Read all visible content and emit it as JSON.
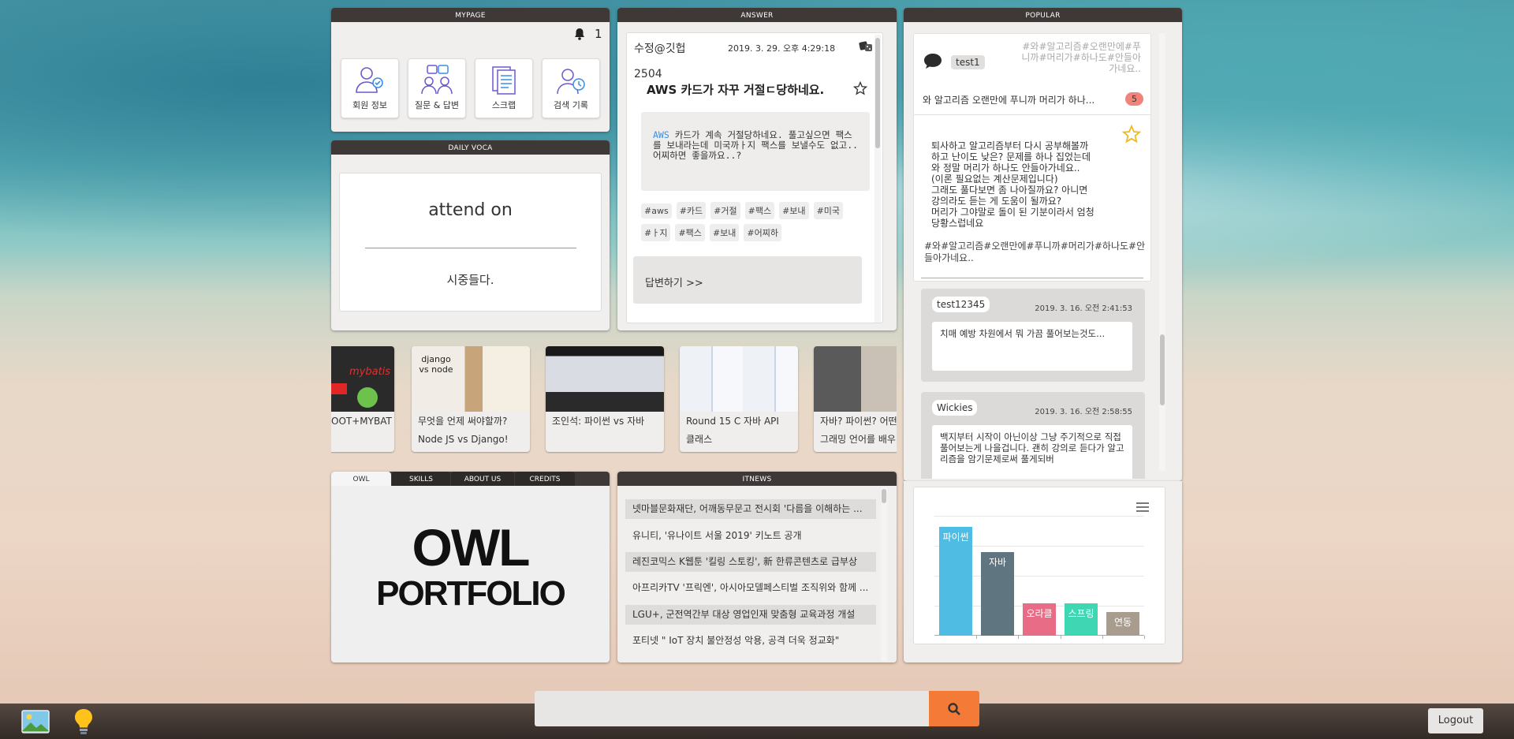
{
  "mypage": {
    "title": "MYPAGE",
    "notification_count": "1",
    "buttons": [
      {
        "label": "회원 정보"
      },
      {
        "label": "질문 & 답변"
      },
      {
        "label": "스크랩"
      },
      {
        "label": "검색 기록"
      }
    ]
  },
  "voca": {
    "title": "DAILY VOCA",
    "word": "attend on",
    "meaning": "시중들다."
  },
  "answer": {
    "title": "ANSWER",
    "author": "수정@깃헙",
    "date": "2019. 3. 29. 오후 4:29:18",
    "number": "2504",
    "question_title": "AWS 카드가 자꾸 거절ㄷ당하네요.",
    "body_prefix": "AWS",
    "body": " 카드가 계속 거절당하네요. 풀고싶으면 팩스를 보내라는데 미국까ㅏ지 팩스를 보낼수도 없고.. 어찌하면 좋을까요..?",
    "tags": [
      "#aws",
      "#카드",
      "#거절",
      "#팩스",
      "#보내",
      "#미국",
      "#ㅏ지",
      "#팩스",
      "#보내",
      "#어찌하"
    ],
    "reply_label": "답변하기 >>"
  },
  "popular": {
    "title": "POPULAR",
    "user": "test1",
    "hashtags_header": "#와#알고리즘#오랜만에#푸니까#머리가#하나도#안들아가네요..",
    "preview": "와 알고리즘 오랜만에 푸니까 머리가 하나...",
    "count": "5",
    "body_lines": [
      "퇴사하고 알고리즘부터 다시 공부해볼까",
      "하고 난이도 낮은? 문제를 하나 집었는데",
      "와 정말 머리가 하나도 안들아가네요..",
      "(이론 필요없는 계산문제입니다)",
      "그래도 풀다보면 좀 나아질까요? 아니면",
      "강의라도 듣는 게 도움이 될까요?",
      "머리가 그야말로 돌이 된 기분이라서 엄청",
      "당황스럽네요"
    ],
    "hashtags_footer": "#와#알고리즘#오랜만에#푸니까#머리가#하나도#안들아가네요..",
    "comments": [
      {
        "user": "test12345",
        "date": "2019. 3. 16. 오전 2:41:53",
        "text": "치매 예방 차원에서 뭐 가끔 풀어보는것도..."
      },
      {
        "user": "Wickies",
        "date": "2019. 3. 16. 오전 2:58:55",
        "text": "백지부터 시작이 아닌이상 그냥 주기적으로 직접 풀어보는게 나을겁니다. 괜히 강의로 듣다가 알고리즘을 암기문제로써 풀게되버"
      }
    ]
  },
  "videos": [
    {
      "title": "OOT+MYBAT",
      "img_text": "mybatis"
    },
    {
      "title": "무엇을 언제 써야할까?",
      "title2": "Node JS vs Django!",
      "img_text": "django vs node"
    },
    {
      "title": "조인석: 파이썬 vs 자바",
      "img_text": ""
    },
    {
      "title": "Round 15 C 자바 API",
      "title2": "클래스",
      "img_text": ""
    },
    {
      "title": "자바? 파이썬? 어떤",
      "title2": "그래밍 언어를 배우",
      "img_text": ""
    }
  ],
  "owl": {
    "tabs": [
      "OWL",
      "SKILLS",
      "ABOUT US",
      "CREDITS"
    ],
    "line1": "OWL",
    "line2": "PORTFOLIO"
  },
  "itnews": {
    "title": "ITNEWS",
    "items": [
      "넷마블문화재단, 어깨동무문고 전시회 '다름을 이해하는 ...",
      "유니티, '유나이트 서울 2019' 키노트 공개",
      "레진코믹스 K웹툰 '킬링 스토킹', 新 한류콘텐츠로 급부상",
      "아프리카TV '프릭엔', 아시아모델페스티벌 조직위와 함께 ...",
      "LGU+, 군전역간부 대상 영업인재 맞춤형 교육과정 개설",
      "포티넷 \" IoT 장치 불안정성 악용, 공격 더욱 정교화\""
    ]
  },
  "search": {
    "placeholder": ""
  },
  "logout_label": "Logout",
  "chart_data": {
    "type": "bar",
    "categories": [
      "파이썬",
      "자바",
      "오라클",
      "스프링",
      "연동"
    ],
    "values": [
      100,
      77,
      30,
      30,
      22
    ],
    "ylim": [
      0,
      110
    ],
    "colors": [
      "#4fbde3",
      "#5f7580",
      "#e86c86",
      "#3fd6b4",
      "#a89c8f"
    ],
    "grid": true,
    "menu_icon": "hamburger-icon"
  }
}
